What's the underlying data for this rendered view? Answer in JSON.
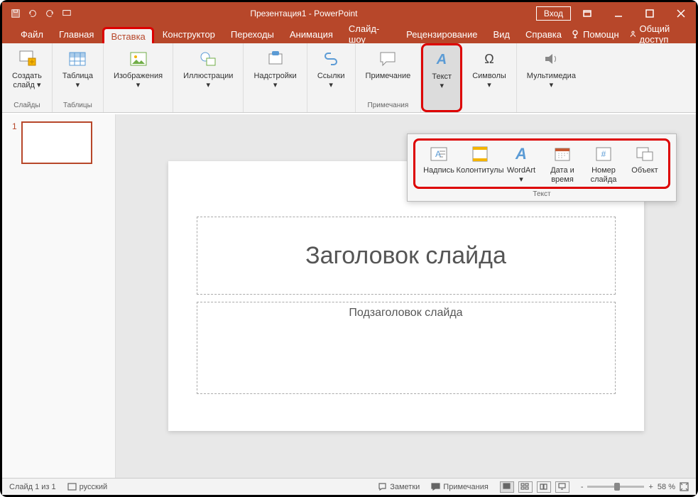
{
  "title": "Презентация1 - PowerPoint",
  "signin": "Вход",
  "tabs": {
    "file": "Файл",
    "home": "Главная",
    "insert": "Вставка",
    "design": "Конструктор",
    "transitions": "Переходы",
    "animations": "Анимация",
    "slideshow": "Слайд-шоу",
    "review": "Рецензирование",
    "view": "Вид",
    "help": "Справка",
    "tellme": "Помощн",
    "share": "Общий доступ"
  },
  "ribbon": {
    "new_slide": "Создать\nслайд ▾",
    "slides_grp": "Слайды",
    "table": "Таблица\n▾",
    "tables_grp": "Таблицы",
    "images": "Изображения\n▾",
    "illustrations": "Иллюстрации\n▾",
    "addins": "Надстройки\n▾",
    "links": "Ссылки\n▾",
    "comment": "Примечание",
    "comments_grp": "Примечания",
    "text": "Текст\n▾",
    "symbols": "Символы\n▾",
    "media": "Мультимедиа\n▾"
  },
  "popup": {
    "textbox": "Надпись",
    "headerfooter": "Колонтитулы",
    "wordart": "WordArt\n▾",
    "datetime": "Дата и\nвремя",
    "slidenumber": "Номер\nслайда",
    "object": "Объект",
    "grp": "Текст"
  },
  "thumbs": {
    "n1": "1"
  },
  "slide": {
    "title_ph": "Заголовок слайда",
    "subtitle_ph": "Подзаголовок слайда"
  },
  "status": {
    "slide": "Слайд 1 из 1",
    "lang": "русский",
    "notes": "Заметки",
    "comments": "Примечания",
    "zoom": "58 %",
    "minus": "-",
    "plus": "+"
  }
}
